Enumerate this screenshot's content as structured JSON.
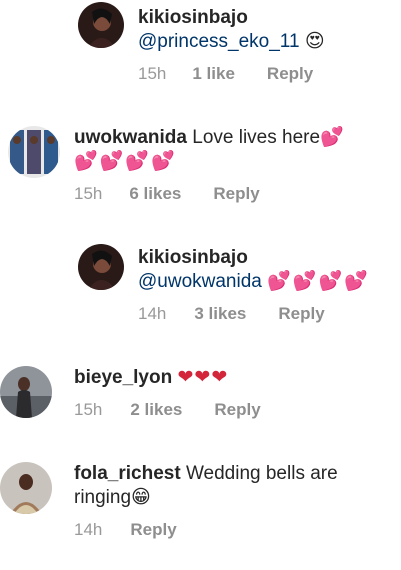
{
  "comments": [
    {
      "username": "kikiosinbajo",
      "mention": "@princess_eko_11",
      "emoji": "😍",
      "time": "15h",
      "likes": "1 like",
      "reply": "Reply"
    },
    {
      "username": "uwokwanida",
      "text": "Love lives here",
      "emoji": "💕",
      "emoji_line2": "💕💕💕💕",
      "time": "15h",
      "likes": "6 likes",
      "reply": "Reply"
    },
    {
      "username": "kikiosinbajo",
      "mention": "@uwokwanida",
      "emoji": "💕💕💕💕",
      "time": "14h",
      "likes": "3 likes",
      "reply": "Reply"
    },
    {
      "username": "bieye_lyon",
      "emoji": "❤❤❤",
      "time": "15h",
      "likes": "2 likes",
      "reply": "Reply"
    },
    {
      "username": "fola_richest",
      "text": "Wedding bells are",
      "text_line2": "ringing",
      "emoji": "😁",
      "time": "14h",
      "reply": "Reply"
    }
  ]
}
